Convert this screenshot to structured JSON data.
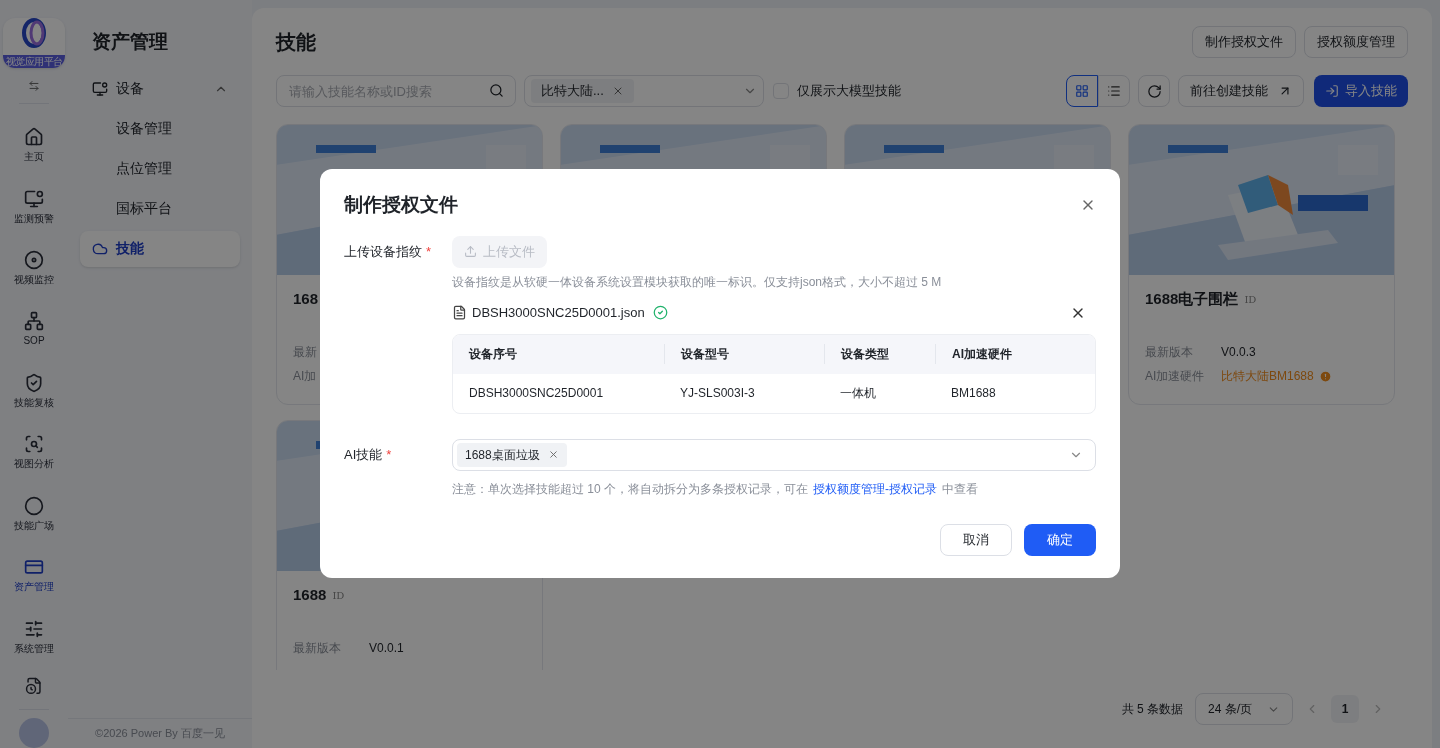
{
  "rail": {
    "logo_text": "视觉应用平台",
    "items": [
      {
        "label": "主页",
        "selected": false
      },
      {
        "label": "监测预警",
        "selected": false
      },
      {
        "label": "视频监控",
        "selected": false
      },
      {
        "label": "SOP",
        "selected": false
      },
      {
        "label": "技能复核",
        "selected": false
      },
      {
        "label": "视图分析",
        "selected": false
      },
      {
        "label": "技能广场",
        "selected": false
      },
      {
        "label": "资产管理",
        "selected": true
      },
      {
        "label": "系统管理",
        "selected": false
      }
    ]
  },
  "sidebar": {
    "title": "资产管理",
    "items": [
      {
        "label": "设备",
        "expanded": true,
        "selected": false,
        "children": [
          {
            "label": "设备管理",
            "selected": false
          },
          {
            "label": "点位管理",
            "selected": false
          },
          {
            "label": "国标平台",
            "selected": false
          }
        ]
      },
      {
        "label": "技能",
        "selected": true
      }
    ],
    "footer": "©2026 Power By 百度一见"
  },
  "page": {
    "title": "技能",
    "header_buttons": [
      "制作授权文件",
      "授权额度管理"
    ],
    "search": {
      "placeholder": "请输入技能名称或ID搜索"
    },
    "filter": {
      "tags": [
        "比特大陆..."
      ]
    },
    "checkbox": {
      "label": "仅展示大模型技能",
      "checked": false
    },
    "views": [
      {
        "kind": "grid",
        "selected": true
      },
      {
        "kind": "list",
        "selected": false
      }
    ],
    "create_button": "前往创建技能",
    "import_button": "导入技能",
    "cards": [
      {
        "kind": "skill",
        "title": "168",
        "rows": [
          {
            "label": "最新"
          },
          {
            "label": "AI加"
          }
        ]
      },
      {
        "kind": "picture"
      },
      {
        "kind": "picture"
      },
      {
        "kind": "skill",
        "title": "1688电子围栏",
        "id_mark": "ID",
        "rows": [
          {
            "label": "最新版本",
            "value": "V0.0.3",
            "kind": "text"
          },
          {
            "label": "AI加速硬件",
            "value": "比特大陆BM1688",
            "kind": "warning"
          }
        ]
      },
      {
        "kind": "skill",
        "title": "1688",
        "id_mark": "ID",
        "rows": [
          {
            "label": "最新版本",
            "value": "V0.0.1",
            "kind": "text"
          }
        ]
      }
    ],
    "pagination": {
      "total": "共 5 条数据",
      "page_size": "24 条/页",
      "pages": [
        {
          "label": "1",
          "selected": true
        }
      ]
    }
  },
  "dialog": {
    "title": "制作授权文件",
    "upload_label": "上传设备指纹",
    "upload_required_mark": "*",
    "upload_button": {
      "label": "上传文件",
      "disabled": true
    },
    "upload_hint": "设备指纹是从软硬一体设备系统设置模块获取的唯一标识。仅支持json格式，大小不超过 5 M",
    "file": {
      "name": "DBSH3000SNC25D0001.json",
      "verified": true
    },
    "table": {
      "columns": [
        "设备序号",
        "设备型号",
        "设备类型",
        "AI加速硬件"
      ],
      "rows": [
        [
          "DBSH3000SNC25D0001",
          "YJ-SLS003I-3",
          "一体机",
          "BM1688"
        ]
      ]
    },
    "skill_label": "AI技能",
    "skill_required_mark": "*",
    "skill_tags": [
      "1688桌面垃圾"
    ],
    "note": "注意：单次选择技能超过 10 个，将自动拆分为多条授权记录，可在",
    "note_link": "授权额度管理-授权记录",
    "note_end": "中查看",
    "cancel": "取消",
    "confirm": "确定"
  }
}
